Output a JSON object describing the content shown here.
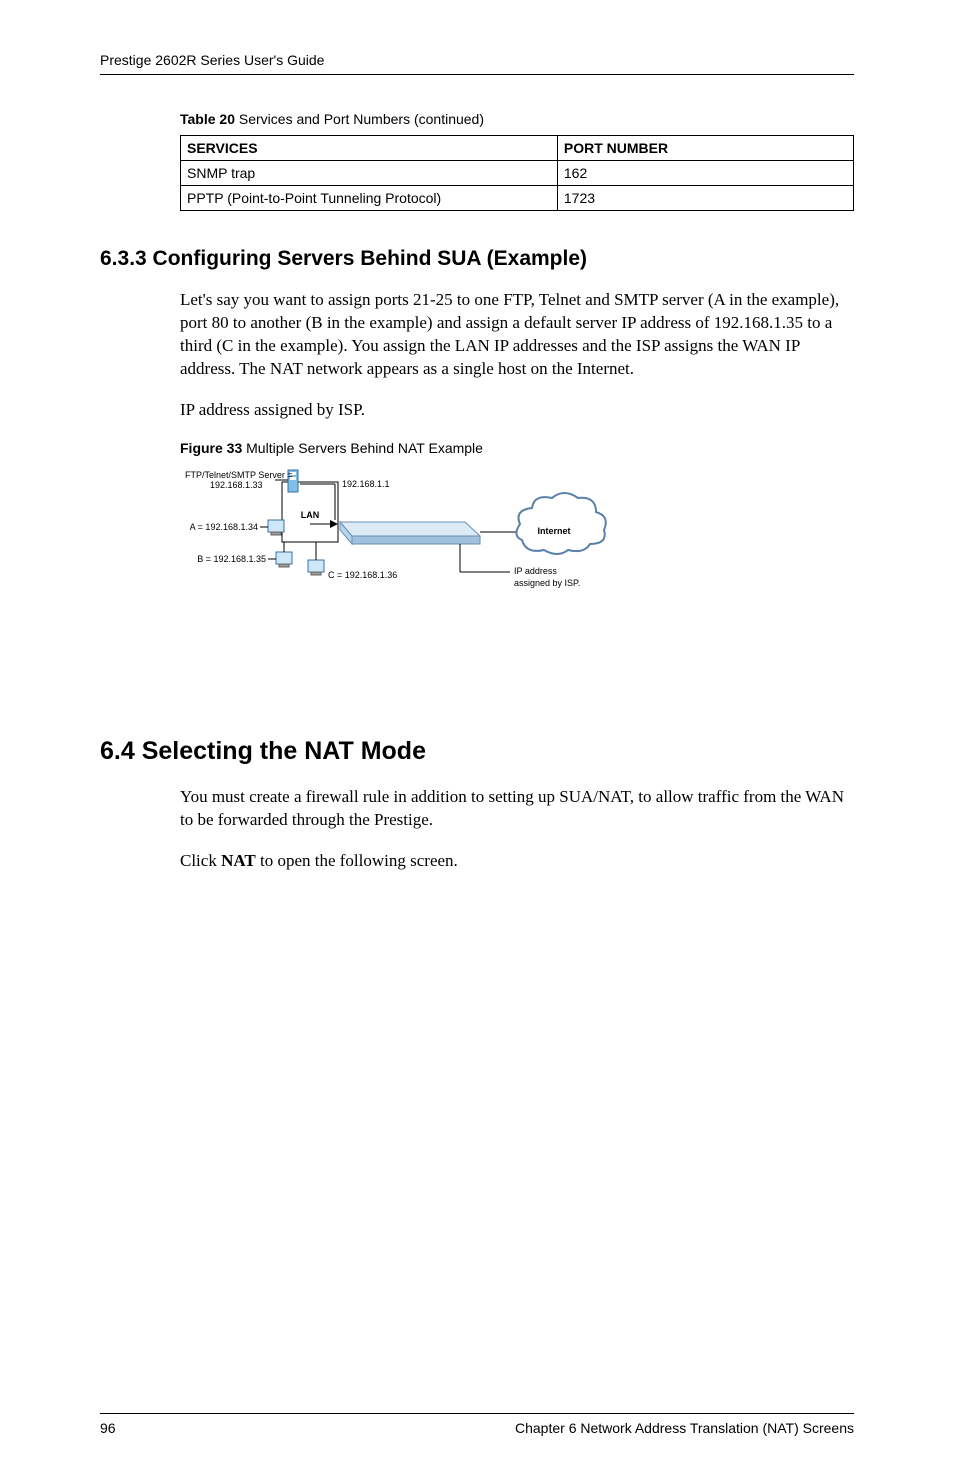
{
  "header": {
    "running_title": "Prestige 2602R Series User's Guide"
  },
  "table20": {
    "label_prefix": "Table 20",
    "label_rest": "   Services and Port Numbers (continued)",
    "columns": {
      "c1": "SERVICES",
      "c2": "PORT NUMBER"
    },
    "rows": [
      {
        "service": "SNMP trap",
        "port": "162"
      },
      {
        "service": "PPTP (Point-to-Point Tunneling Protocol)",
        "port": "1723"
      }
    ]
  },
  "section_633": {
    "heading": "6.3.3  Configuring Servers Behind SUA (Example)",
    "para1": "Let's say you want to assign ports 21-25 to one FTP, Telnet and SMTP server (A in the example), port 80 to another (B in the example) and assign a default server IP address of 192.168.1.35 to a third (C in the example). You assign the LAN IP addresses and the ISP assigns the WAN IP address. The NAT network appears as a single host on the Internet.",
    "para2": "IP address assigned by ISP."
  },
  "figure33": {
    "label_prefix": "Figure 33",
    "label_rest": "   Multiple Servers Behind NAT Example",
    "labels": {
      "ftp_server_line1": "FTP/Telnet/SMTP Server =",
      "ftp_server_line2": "192.168.1.33",
      "gateway_ip": "192.168.1.1",
      "host_a": "A = 192.168.1.34",
      "host_b": "B = 192.168.1.35",
      "host_c": "C = 192.168.1.36",
      "lan": "LAN",
      "internet": "Internet",
      "isp_line1": "IP address",
      "isp_line2": "assigned by ISP."
    }
  },
  "section_64": {
    "heading": "6.4  Selecting the NAT Mode",
    "para1": "You must create a firewall rule in addition to setting up SUA/NAT, to allow traffic from the WAN to be forwarded through the Prestige.",
    "para2_pre": "Click ",
    "para2_bold": "NAT",
    "para2_post": " to open the following screen."
  },
  "footer": {
    "page_number": "96",
    "chapter": "Chapter 6 Network Address Translation (NAT) Screens"
  }
}
